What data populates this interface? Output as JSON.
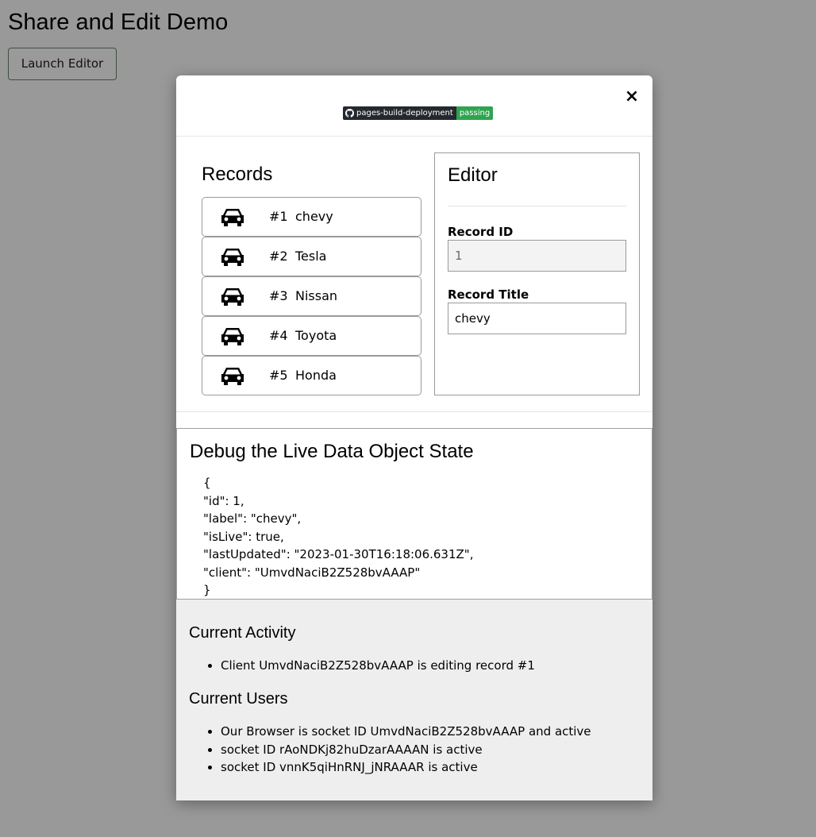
{
  "page": {
    "title": "Share and Edit Demo",
    "launch_button": "Launch Editor"
  },
  "modal": {
    "badge": {
      "left": "pages-build-deployment",
      "right": "passing"
    },
    "close_label": "×",
    "records": {
      "title": "Records",
      "icon": "car-icon",
      "items": [
        {
          "num": "#1",
          "label": "chevy"
        },
        {
          "num": "#2",
          "label": "Tesla"
        },
        {
          "num": "#3",
          "label": "Nissan"
        },
        {
          "num": "#4",
          "label": "Toyota"
        },
        {
          "num": "#5",
          "label": "Honda"
        }
      ]
    },
    "editor": {
      "title": "Editor",
      "record_id_label": "Record ID",
      "record_id_value": "1",
      "record_title_label": "Record Title",
      "record_title_value": "chevy"
    },
    "debug": {
      "title": "Debug the Live Data Object State",
      "lines": [
        "{",
        "\"id\": 1,",
        "\"label\": \"chevy\",",
        "\"isLive\": true,",
        "\"lastUpdated\": \"2023-01-30T16:18:06.631Z\",",
        "\"client\": \"UmvdNaciB2Z528bvAAAP\"",
        "}"
      ]
    },
    "activity": {
      "title": "Current Activity",
      "items": [
        "Client UmvdNaciB2Z528bvAAAP is editing record #1"
      ]
    },
    "users": {
      "title": "Current Users",
      "items": [
        "Our Browser is socket ID UmvdNaciB2Z528bvAAAP and active",
        "socket ID rAoNDKj82huDzarAAAAN is active",
        "socket ID vnnK5qiHnRNJ_jNRAAAR is active"
      ]
    }
  }
}
